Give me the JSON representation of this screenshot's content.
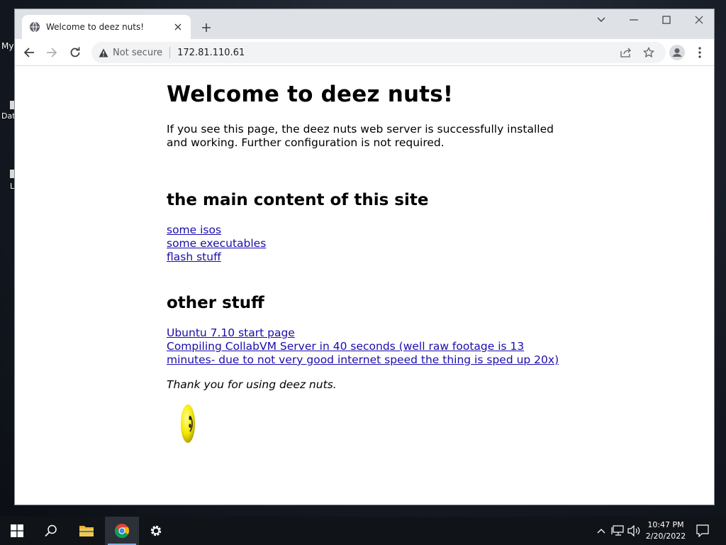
{
  "desktop": {
    "icons": [
      {
        "label": "My"
      },
      {
        "label": "Dat"
      },
      {
        "label": "L"
      }
    ]
  },
  "browser": {
    "tab_title": "Welcome to deez nuts!",
    "security_label": "Not secure",
    "url": "172.81.110.61"
  },
  "page": {
    "heading": "Welcome to deez nuts!",
    "intro": "If you see this page, the deez nuts web server is successfully installed and working. Further configuration is not required.",
    "section1_title": "the main content of this site",
    "section1_links": [
      "some isos",
      "some executables",
      "flash stuff"
    ],
    "section2_title": "other stuff",
    "section2_links": [
      "Ubuntu 7.10 start page",
      "Compiling CollabVM Server in 40 seconds (well raw footage is 13 minutes- due to not very good internet speed the thing is sped up 20x)"
    ],
    "thanks": "Thank you for using deez nuts."
  },
  "taskbar": {
    "time": "10:47 PM",
    "date": "2/20/2022"
  },
  "colors": {
    "link": "#1a0dab",
    "tabstrip": "#dee1e6",
    "taskbar": "#101317"
  }
}
